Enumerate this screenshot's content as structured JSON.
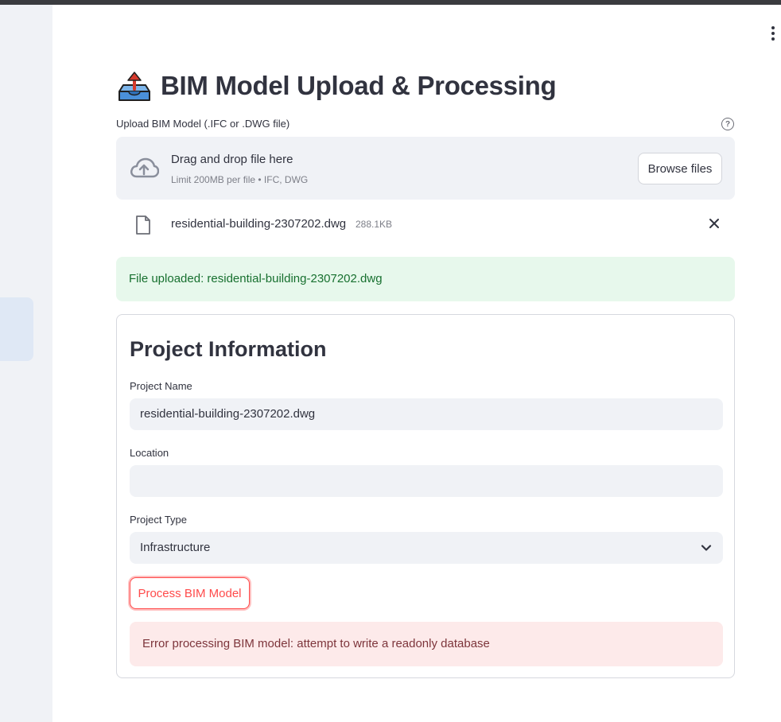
{
  "app": {
    "title": "BIM Model Upload & Processing",
    "title_icon": "outbox-tray-icon",
    "menu_icon": "vertical-ellipsis-icon"
  },
  "uploader": {
    "label": "Upload BIM Model (.IFC or .DWG file)",
    "help_icon": "question-circle-icon",
    "dropzone_title": "Drag and drop file here",
    "dropzone_subtitle": "Limit 200MB per file • IFC, DWG",
    "browse_label": "Browse files",
    "upload_icon": "cloud-upload-icon"
  },
  "uploaded_file": {
    "name": "residential-building-2307202.dwg",
    "size": "288.1KB",
    "icon": "file-icon",
    "remove_icon": "close-icon"
  },
  "success_message": "File uploaded: residential-building-2307202.dwg",
  "project_form": {
    "title": "Project Information",
    "name_label": "Project Name",
    "name_value": "residential-building-2307202.dwg",
    "location_label": "Location",
    "location_value": "",
    "type_label": "Project Type",
    "type_value": "Infrastructure",
    "process_label": "Process BIM Model",
    "error_message": "Error processing BIM model: attempt to write a readonly database"
  },
  "colors": {
    "accent": "#ff4b4b",
    "success_bg": "#e7f8ec",
    "success_text": "#17702f",
    "error_bg": "#fdeaea",
    "error_text": "#7d353b",
    "input_bg": "#f0f2f6"
  }
}
